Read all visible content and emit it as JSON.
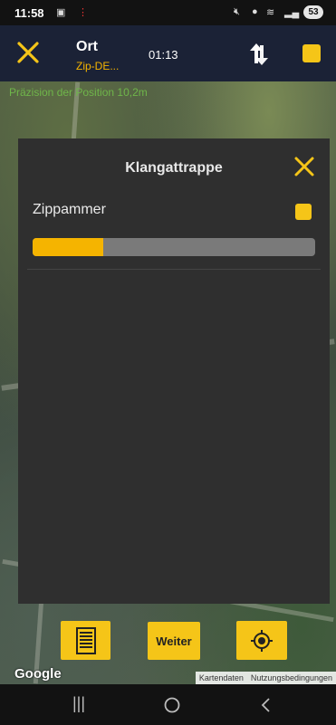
{
  "status_bar": {
    "time": "11:58",
    "battery": "53"
  },
  "header": {
    "title": "Ort",
    "subtitle": "Zip-DE...",
    "timer": "01:13"
  },
  "map": {
    "precision_text": "Präzision der Position 10,2m",
    "logo_text": "Google",
    "attribution": {
      "map_data": "Kartendaten",
      "terms": "Nutzungsbedingungen"
    }
  },
  "dialog": {
    "title": "Klangattrappe",
    "species": "Zippammer",
    "progress_fraction": 0.25
  },
  "bottom_buttons": {
    "next_label": "Weiter"
  },
  "colors": {
    "accent": "#f5c518",
    "progress_fill": "#f5b400",
    "precision_text": "#6fb64a"
  }
}
